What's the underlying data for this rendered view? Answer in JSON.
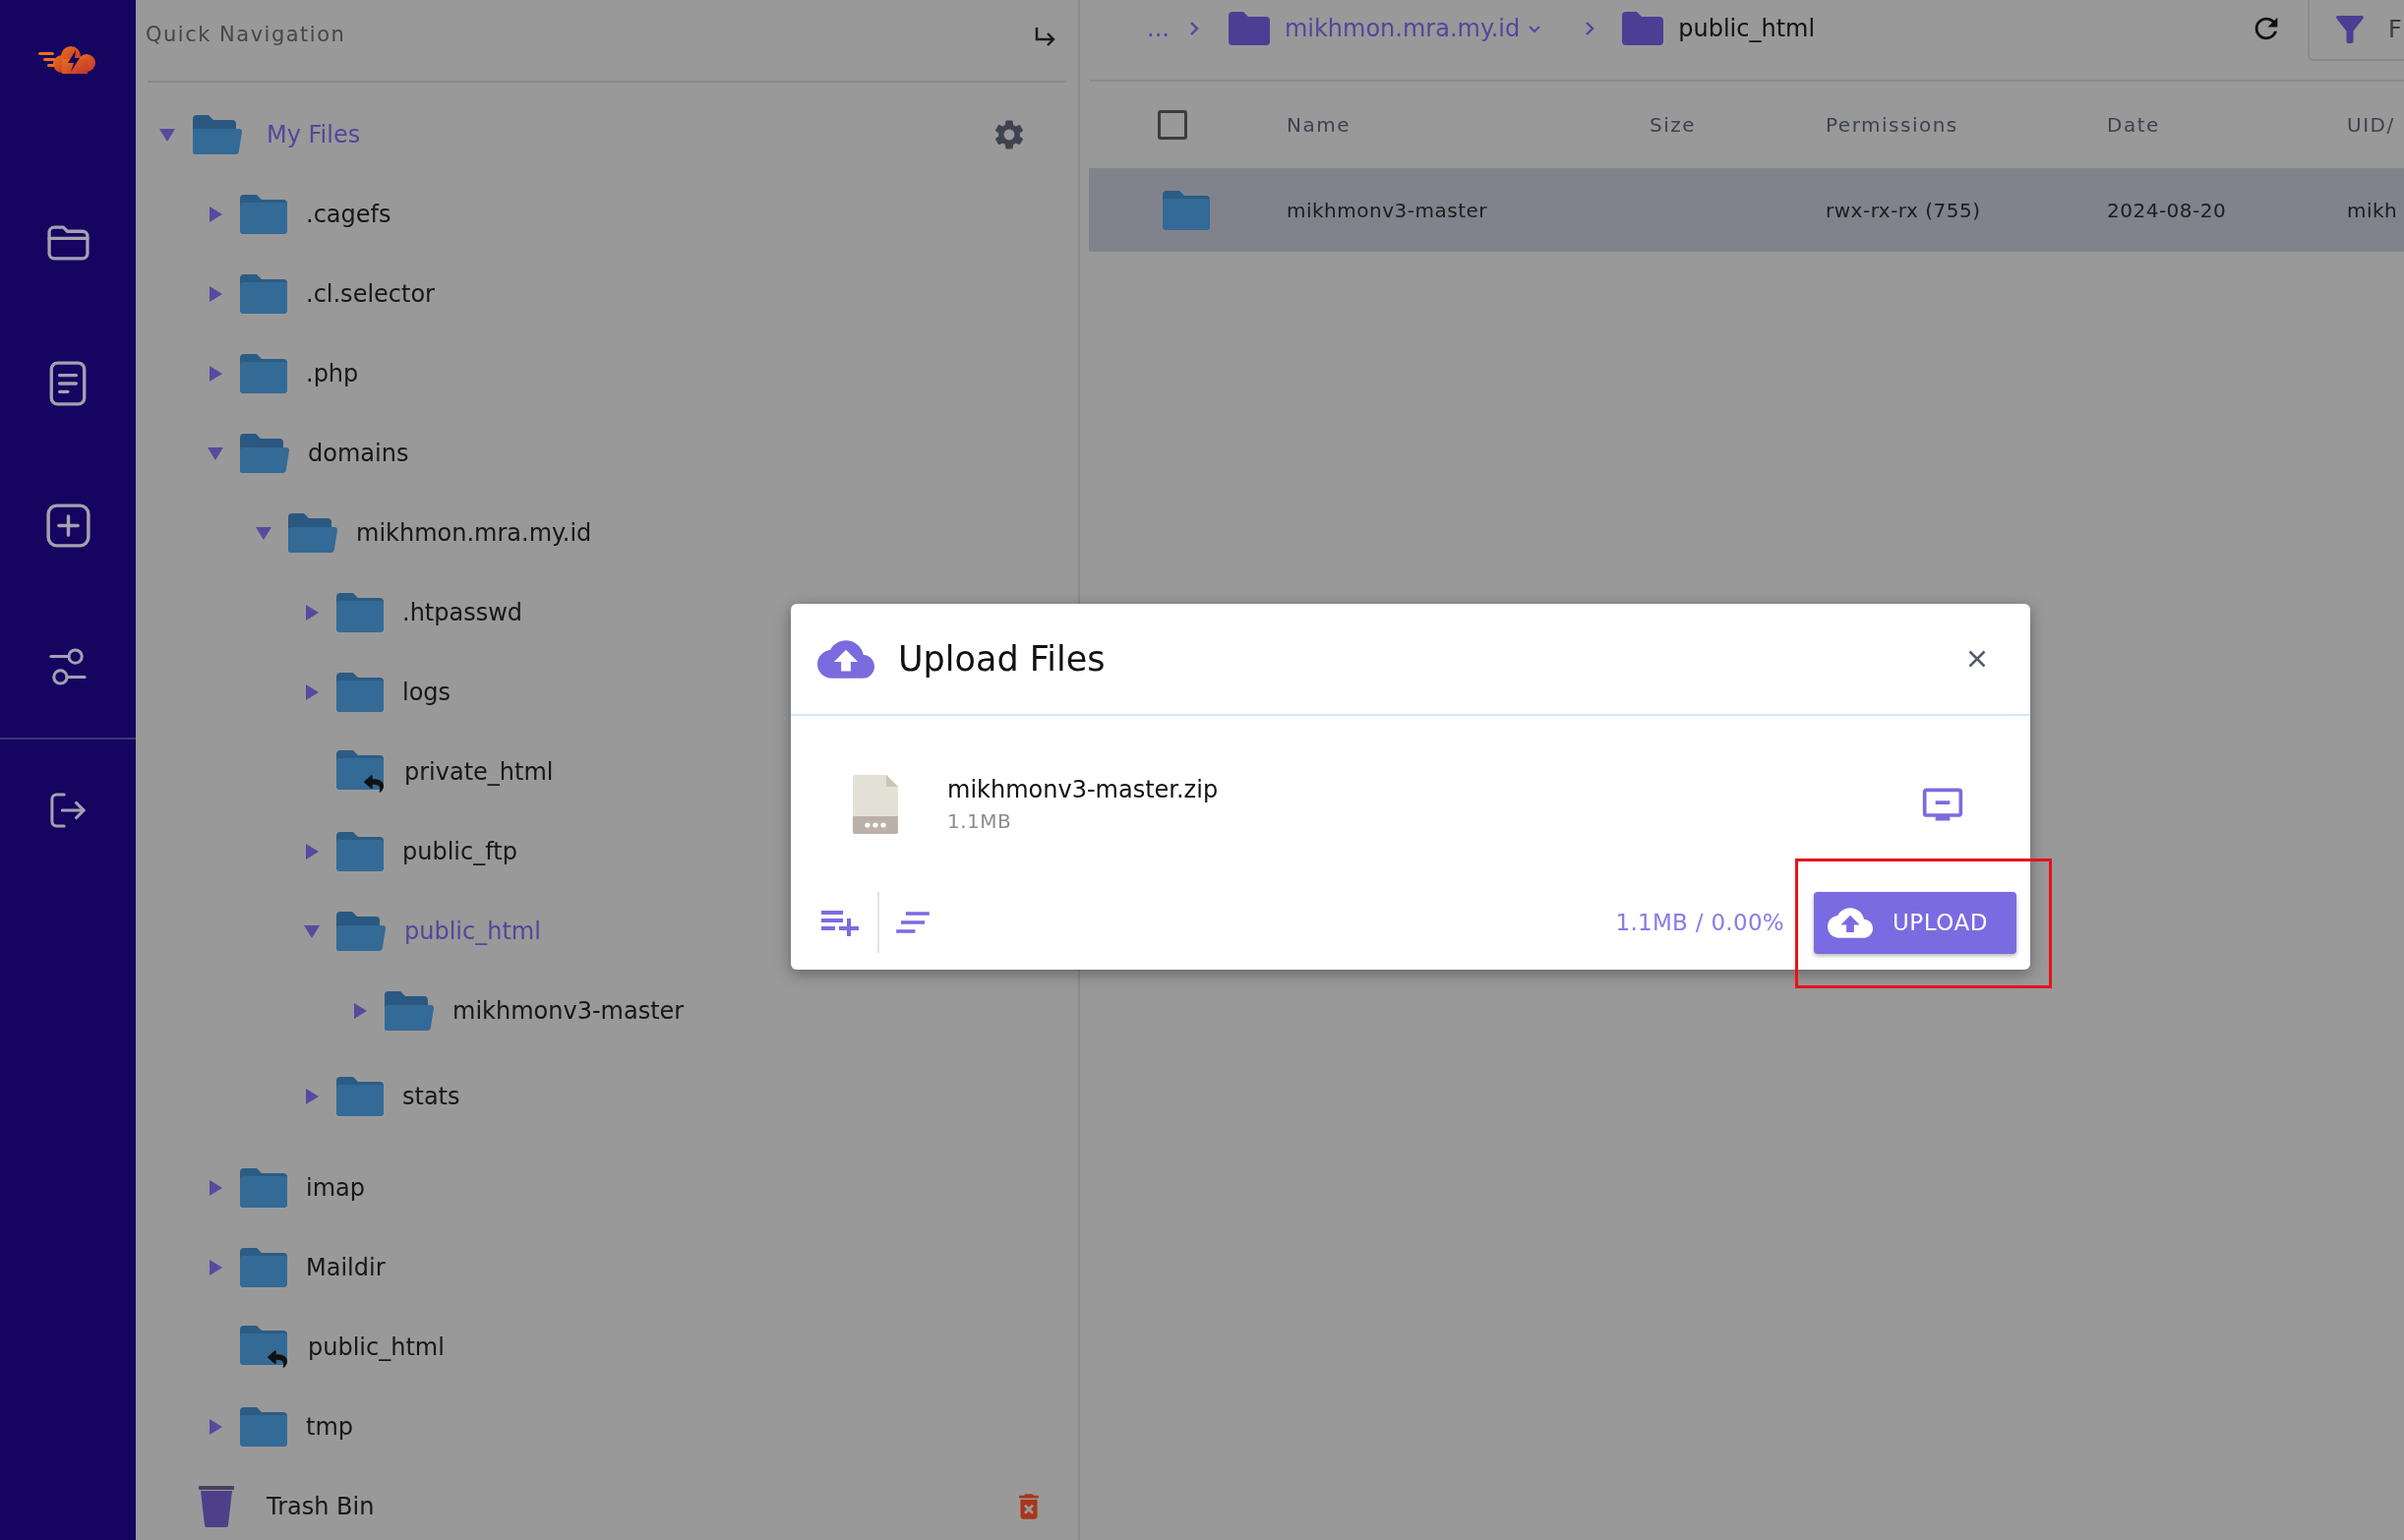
{
  "quick_navigation": {
    "title": "Quick Navigation"
  },
  "tree": {
    "label": "My Files",
    "expanded": true,
    "children": [
      {
        "kind": "folder",
        "label": ".cagefs",
        "expanded": false,
        "open": false,
        "selected": false
      },
      {
        "kind": "folder",
        "label": ".cl.selector",
        "expanded": false,
        "open": false,
        "selected": false
      },
      {
        "kind": "folder",
        "label": ".php",
        "expanded": false,
        "open": false,
        "selected": false
      },
      {
        "kind": "folder",
        "label": "domains",
        "expanded": true,
        "open": true,
        "selected": false,
        "children": [
          {
            "kind": "folder",
            "label": "mikhmon.mra.my.id",
            "expanded": true,
            "open": true,
            "selected": false,
            "children": [
              {
                "kind": "folder",
                "label": ".htpasswd",
                "expanded": false,
                "open": false,
                "selected": false
              },
              {
                "kind": "folder",
                "label": "logs",
                "expanded": false,
                "open": false,
                "selected": false
              },
              {
                "kind": "link",
                "label": "private_html",
                "selected": false
              },
              {
                "kind": "folder",
                "label": "public_ftp",
                "expanded": false,
                "open": false,
                "selected": false
              },
              {
                "kind": "folder",
                "label": "public_html",
                "expanded": true,
                "open": true,
                "selected": true,
                "children": [
                  {
                    "kind": "folder",
                    "label": "mikhmonv3-master",
                    "expanded": false,
                    "open": true,
                    "selected": false
                  }
                ]
              },
              {
                "kind": "folder",
                "label": "stats",
                "expanded": false,
                "open": false,
                "selected": false
              }
            ]
          }
        ]
      },
      {
        "kind": "folder",
        "label": "imap",
        "expanded": false,
        "open": false,
        "selected": false
      },
      {
        "kind": "folder",
        "label": "Maildir",
        "expanded": false,
        "open": false,
        "selected": false
      },
      {
        "kind": "link",
        "label": "public_html",
        "selected": false
      },
      {
        "kind": "folder",
        "label": "tmp",
        "expanded": false,
        "open": false,
        "selected": false
      }
    ]
  },
  "trash": {
    "label": "Trash Bin"
  },
  "breadcrumb": {
    "overflow": "...",
    "items": [
      {
        "label": "mikhmon.mra.my.id",
        "current": false,
        "menu": true
      },
      {
        "label": "public_html",
        "current": true,
        "menu": false
      }
    ]
  },
  "toolbar": {
    "filter_label": "F"
  },
  "table": {
    "select_all": {
      "checked": false
    },
    "columns": [
      "Name",
      "Size",
      "Permissions",
      "Date",
      "UID/"
    ],
    "rows": [
      {
        "kind": "folder",
        "selected": true,
        "name": "mikhmonv3-master",
        "permissions": "rwx-rx-rx (755)",
        "date": "2024-08-20",
        "column_5": "mikh"
      }
    ]
  },
  "upload_dialog": {
    "title": "Upload Files",
    "files": [
      {
        "name": "mikhmonv3-master.zip",
        "size": "1.1MB"
      }
    ],
    "summary": "1.1MB / 0.00%",
    "upload_button": {
      "label": "UPLOAD"
    }
  }
}
